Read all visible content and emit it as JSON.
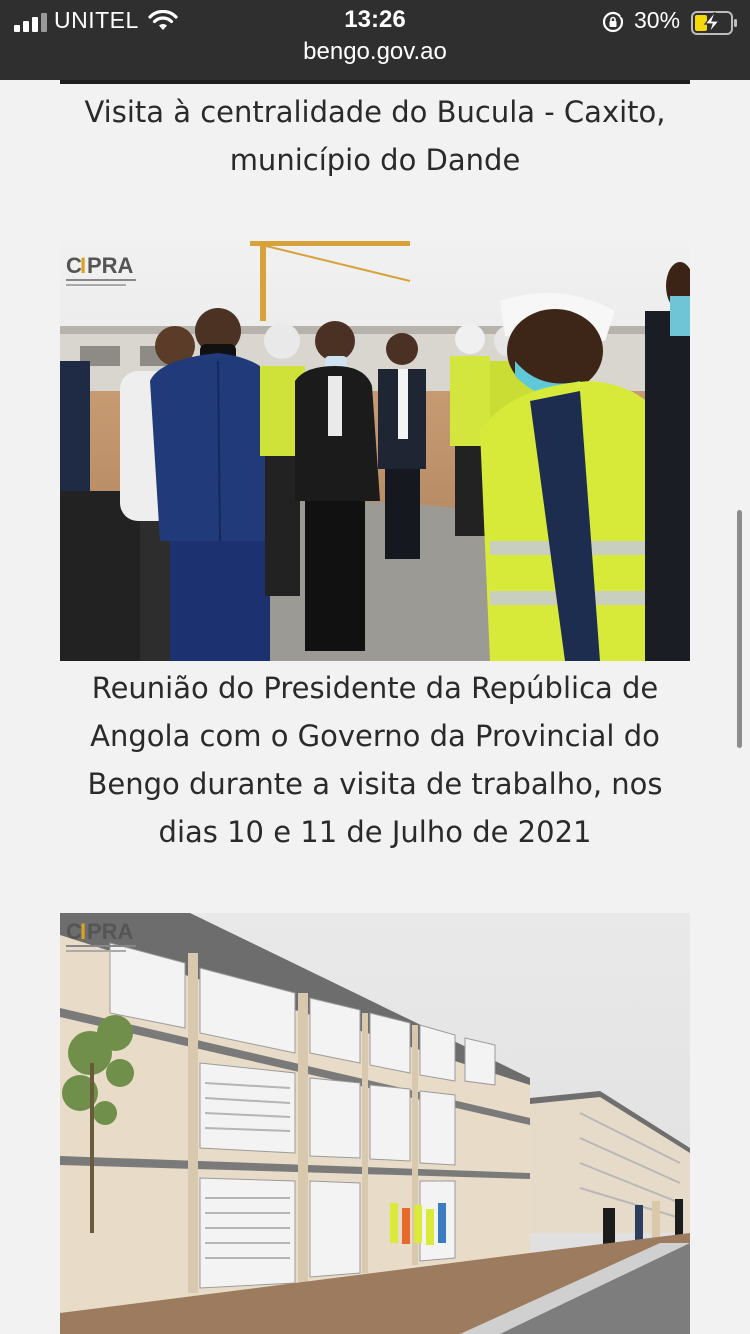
{
  "status_bar": {
    "carrier": "UNITEL",
    "time": "13:26",
    "battery_percent": "30%",
    "url": "bengo.gov.ao"
  },
  "articles": [
    {
      "caption": "Visita à centralidade do Bucula - Caxito, município do Dande"
    },
    {
      "caption": "Reunião do Presidente da República de Angola com o Governo da Provincial do Bengo durante a visita de trabalho, nos dias 10 e 11 de Julho de 2021",
      "image_watermark": "CIPRA"
    },
    {
      "image_watermark": "CIPRA"
    }
  ],
  "colors": {
    "status_bar_bg": "#2f2f2f",
    "page_bg": "#f2f2f2",
    "vest_yellow": "#d7ea3a",
    "battery_charging": "#f5d90a"
  },
  "icons": [
    "signal-icon",
    "wifi-icon",
    "orientation-lock-icon",
    "battery-charging-icon",
    "scrollbar"
  ]
}
